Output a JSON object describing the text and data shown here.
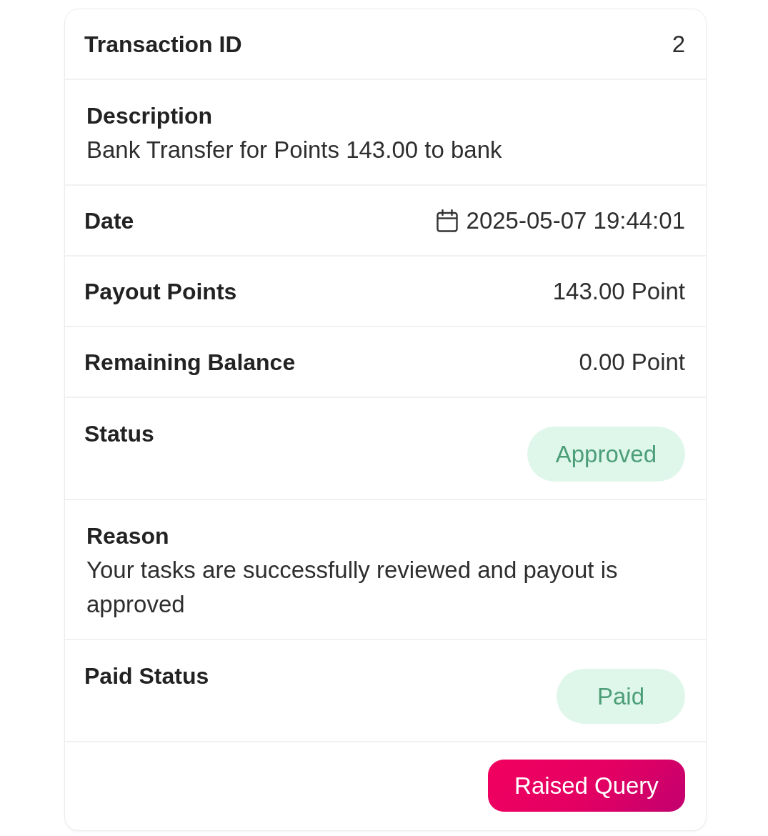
{
  "fields": [
    {
      "kind": "inline",
      "label": "Transaction ID",
      "value": "2"
    },
    {
      "kind": "stacked",
      "label": "Description",
      "value": "Bank Transfer for Points 143.00 to bank"
    },
    {
      "kind": "date",
      "label": "Date",
      "value": "2025-05-07 19:44:01"
    },
    {
      "kind": "inline",
      "label": "Payout Points",
      "value": "143.00 Point"
    },
    {
      "kind": "inline",
      "label": "Remaining Balance",
      "value": "0.00 Point"
    },
    {
      "kind": "badge",
      "label": "Status",
      "value": "Approved"
    },
    {
      "kind": "stacked",
      "label": "Reason",
      "value": "Your tasks are successfully reviewed and payout is approved"
    },
    {
      "kind": "badge",
      "label": "Paid Status",
      "value": "Paid"
    }
  ],
  "actions": [
    {
      "label": "Raised Query"
    }
  ]
}
